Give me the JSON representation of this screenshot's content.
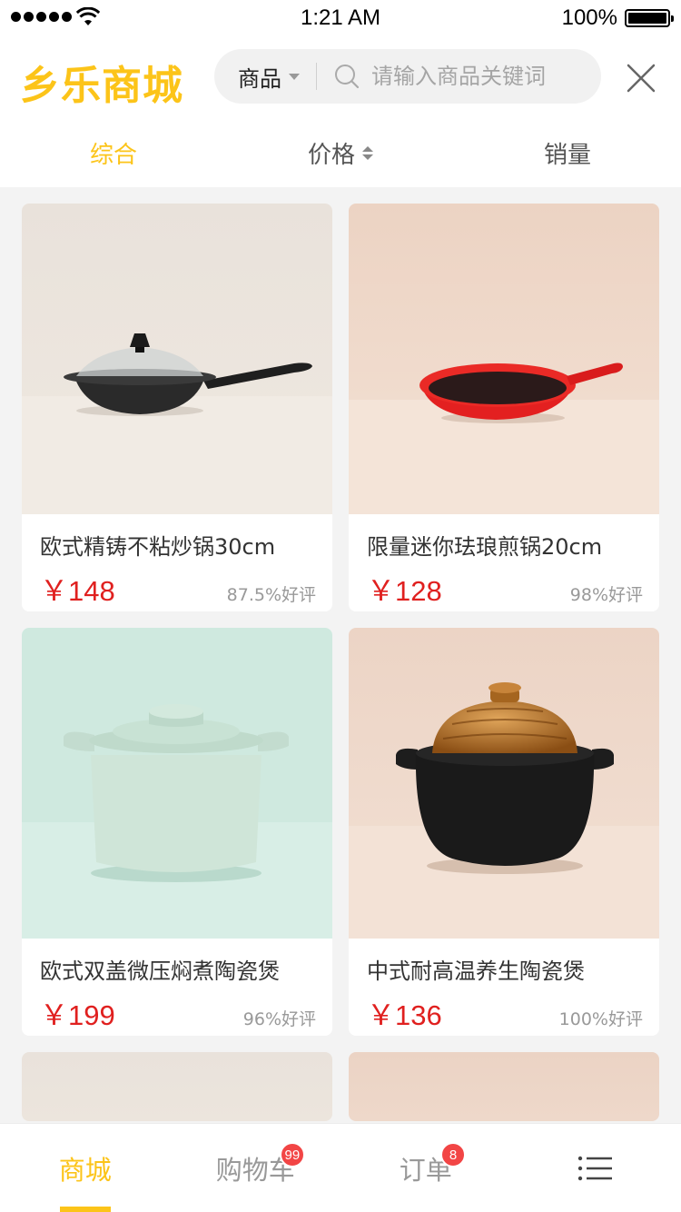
{
  "status_bar": {
    "time": "1:21 AM",
    "battery": "100%"
  },
  "header": {
    "logo": "乡乐商城",
    "category": "商品",
    "search_placeholder": "请输入商品关键词"
  },
  "sort_tabs": [
    {
      "label": "综合",
      "active": true
    },
    {
      "label": "价格",
      "active": false
    },
    {
      "label": "销量",
      "active": false
    }
  ],
  "products": [
    {
      "title": "欧式精铸不粘炒锅30cm",
      "price": "￥148",
      "rating": "87.5%好评",
      "image": "black-wok-with-glass-lid"
    },
    {
      "title": "限量迷你珐琅煎锅20cm",
      "price": "￥128",
      "rating": "98%好评",
      "image": "red-enamel-skillet"
    },
    {
      "title": "欧式双盖微压焖煮陶瓷煲",
      "price": "￥199",
      "rating": "96%好评",
      "image": "mint-ceramic-casserole"
    },
    {
      "title": "中式耐高温养生陶瓷煲",
      "price": "￥136",
      "rating": "100%好评",
      "image": "black-clay-pot-amber-lid"
    }
  ],
  "tab_bar": [
    {
      "label": "商城",
      "active": true
    },
    {
      "label": "购物车",
      "badge": "99"
    },
    {
      "label": "订单",
      "badge": "8"
    },
    {
      "label": "",
      "icon": "menu-icon"
    }
  ],
  "colors": {
    "accent": "#fcc419",
    "price": "#e0201f",
    "badge": "#f24545"
  }
}
